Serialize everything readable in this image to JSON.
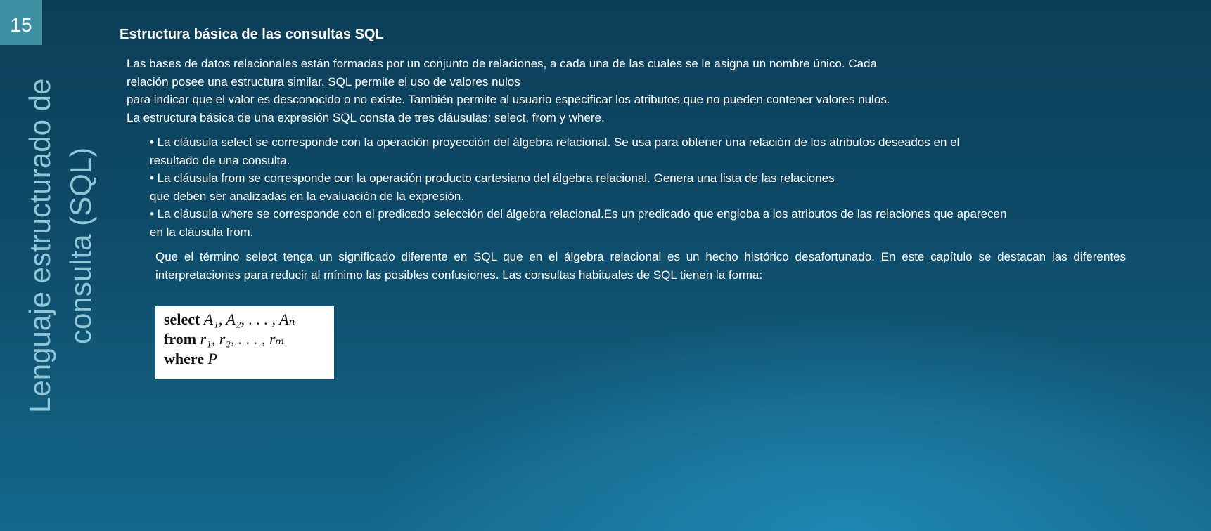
{
  "slide": {
    "number": "15",
    "vertical_title": "Lenguaje estructurado de consulta (SQL)"
  },
  "content": {
    "heading": "Estructura básica de las consultas SQL",
    "intro_lines": [
      "Las bases de datos relacionales  están formadas  por un conjunto de relaciones,  a cada una de las cuales se le asigna un nombre único. Cada",
      "relación  posee una estructura similar. SQL permite el uso de valores nulos",
      "para indicar que el valor es desconocido  o no existe. También permite al usuario especificar  los atributos que no pueden contener valores nulos.",
      "La estructura básica de una expresión SQL consta de tres cláusulas:  select,  from y where."
    ],
    "bullet_lines": [
      "• La cláusula select se corresponde  con la operación proyección del álgebra relacional. Se usa para obtener una relación de los atributos deseados  en el",
      "resultado de una consulta.",
      "• La cláusula from se corresponde  con la operación producto cartesiano del álgebra relacional. Genera una lista de las relaciones",
      "que deben ser analizadas en la evaluación de la expresión.",
      "• La cláusula where se corresponde  con el predicado selección del álgebra relacional.Es un predicado que engloba a los atributos de las relaciones que aparecen",
      "en la cláusula from."
    ],
    "closing": "Que el término select tenga un significado diferente en SQL que en el álgebra relacional es un hecho histórico desafortunado.  En este capítulo se destacan las diferentes interpretaciones  para reducir al mínimo las posibles confusiones.  Las consultas habituales de SQL tienen la forma:"
  },
  "formula": {
    "select_kw": "select",
    "select_args": "A₁,  A₂, . . . , Aₙ",
    "from_kw": "from",
    "from_args": "r₁,  r₂, . . . , rₘ",
    "where_kw": "where",
    "where_args": "P"
  },
  "colors": {
    "background_top": "#0d3e58",
    "background_glow": "#1f86b2",
    "slide_number_box": "#3e8fa2",
    "vertical_title": "#8fc7d8",
    "text": "#ffffff"
  }
}
